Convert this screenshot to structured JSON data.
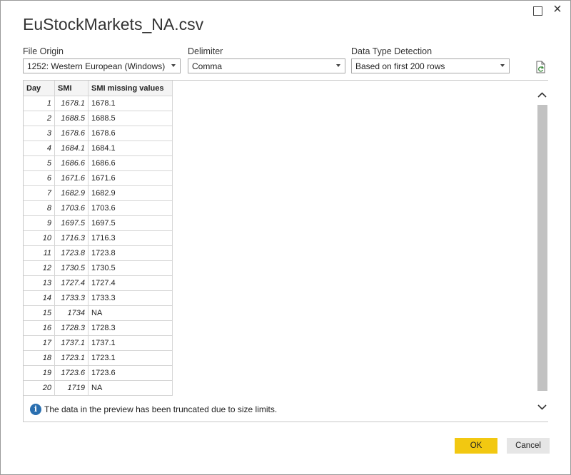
{
  "window": {
    "title": "EuStockMarkets_NA.csv"
  },
  "options": {
    "file_origin": {
      "label": "File Origin",
      "value": "1252: Western European (Windows)"
    },
    "delimiter": {
      "label": "Delimiter",
      "value": "Comma"
    },
    "detection": {
      "label": "Data Type Detection",
      "value": "Based on first 200 rows"
    }
  },
  "table": {
    "columns": [
      "Day",
      "SMI",
      "SMI missing values"
    ],
    "rows": [
      [
        "1",
        "1678.1",
        "1678.1"
      ],
      [
        "2",
        "1688.5",
        "1688.5"
      ],
      [
        "3",
        "1678.6",
        "1678.6"
      ],
      [
        "4",
        "1684.1",
        "1684.1"
      ],
      [
        "5",
        "1686.6",
        "1686.6"
      ],
      [
        "6",
        "1671.6",
        "1671.6"
      ],
      [
        "7",
        "1682.9",
        "1682.9"
      ],
      [
        "8",
        "1703.6",
        "1703.6"
      ],
      [
        "9",
        "1697.5",
        "1697.5"
      ],
      [
        "10",
        "1716.3",
        "1716.3"
      ],
      [
        "11",
        "1723.8",
        "1723.8"
      ],
      [
        "12",
        "1730.5",
        "1730.5"
      ],
      [
        "13",
        "1727.4",
        "1727.4"
      ],
      [
        "14",
        "1733.3",
        "1733.3"
      ],
      [
        "15",
        "1734",
        "NA"
      ],
      [
        "16",
        "1728.3",
        "1728.3"
      ],
      [
        "17",
        "1737.1",
        "1737.1"
      ],
      [
        "18",
        "1723.1",
        "1723.1"
      ],
      [
        "19",
        "1723.6",
        "1723.6"
      ],
      [
        "20",
        "1719",
        "NA"
      ]
    ]
  },
  "notice": {
    "icon": "info-icon",
    "text": "The data in the preview has been truncated due to size limits."
  },
  "buttons": {
    "ok": "OK",
    "cancel": "Cancel"
  },
  "colors": {
    "ok_button": "#f2c811",
    "info_icon": "#2a6fb0"
  }
}
